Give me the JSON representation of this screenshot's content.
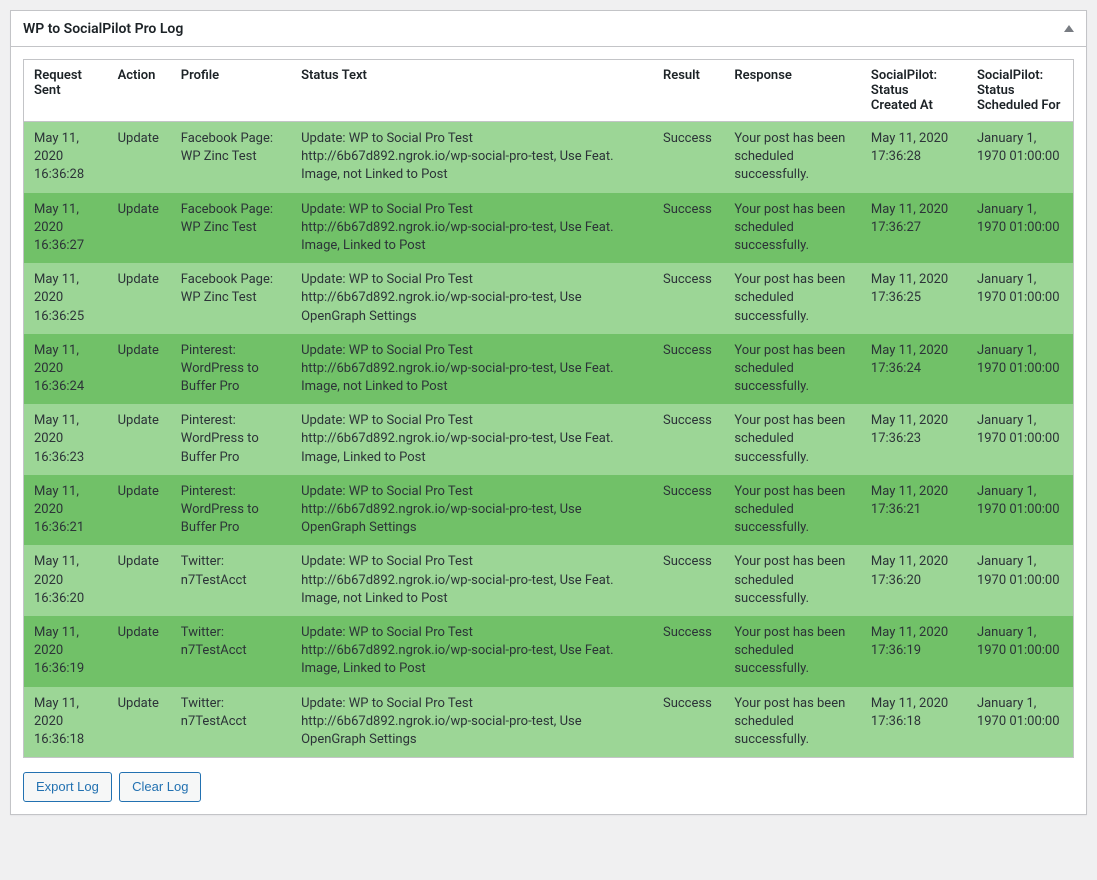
{
  "panel": {
    "title": "WP to SocialPilot Pro Log"
  },
  "table": {
    "headers": {
      "request_sent": "Request Sent",
      "action": "Action",
      "profile": "Profile",
      "status_text": "Status Text",
      "result": "Result",
      "response": "Response",
      "created_at": "SocialPilot: Status Created At",
      "scheduled_for": "SocialPilot: Status Scheduled For"
    },
    "rows": [
      {
        "request_sent": "May 11, 2020 16:36:28",
        "action": "Update",
        "profile": "Facebook Page: WP Zinc Test",
        "status_text": "Update: WP to Social Pro Test http://6b67d892.ngrok.io/wp-social-pro-test, Use Feat. Image, not Linked to Post",
        "result": "Success",
        "response": "Your post has been scheduled successfully.",
        "created_at": "May 11, 2020 17:36:28",
        "scheduled_for": "January 1, 1970 01:00:00"
      },
      {
        "request_sent": "May 11, 2020 16:36:27",
        "action": "Update",
        "profile": "Facebook Page: WP Zinc Test",
        "status_text": "Update: WP to Social Pro Test http://6b67d892.ngrok.io/wp-social-pro-test, Use Feat. Image, Linked to Post",
        "result": "Success",
        "response": "Your post has been scheduled successfully.",
        "created_at": "May 11, 2020 17:36:27",
        "scheduled_for": "January 1, 1970 01:00:00"
      },
      {
        "request_sent": "May 11, 2020 16:36:25",
        "action": "Update",
        "profile": "Facebook Page: WP Zinc Test",
        "status_text": "Update: WP to Social Pro Test http://6b67d892.ngrok.io/wp-social-pro-test, Use OpenGraph Settings",
        "result": "Success",
        "response": "Your post has been scheduled successfully.",
        "created_at": "May 11, 2020 17:36:25",
        "scheduled_for": "January 1, 1970 01:00:00"
      },
      {
        "request_sent": "May 11, 2020 16:36:24",
        "action": "Update",
        "profile": "Pinterest: WordPress to Buffer Pro",
        "status_text": "Update: WP to Social Pro Test http://6b67d892.ngrok.io/wp-social-pro-test, Use Feat. Image, not Linked to Post",
        "result": "Success",
        "response": "Your post has been scheduled successfully.",
        "created_at": "May 11, 2020 17:36:24",
        "scheduled_for": "January 1, 1970 01:00:00"
      },
      {
        "request_sent": "May 11, 2020 16:36:23",
        "action": "Update",
        "profile": "Pinterest: WordPress to Buffer Pro",
        "status_text": "Update: WP to Social Pro Test http://6b67d892.ngrok.io/wp-social-pro-test, Use Feat. Image, Linked to Post",
        "result": "Success",
        "response": "Your post has been scheduled successfully.",
        "created_at": "May 11, 2020 17:36:23",
        "scheduled_for": "January 1, 1970 01:00:00"
      },
      {
        "request_sent": "May 11, 2020 16:36:21",
        "action": "Update",
        "profile": "Pinterest: WordPress to Buffer Pro",
        "status_text": "Update: WP to Social Pro Test http://6b67d892.ngrok.io/wp-social-pro-test, Use OpenGraph Settings",
        "result": "Success",
        "response": "Your post has been scheduled successfully.",
        "created_at": "May 11, 2020 17:36:21",
        "scheduled_for": "January 1, 1970 01:00:00"
      },
      {
        "request_sent": "May 11, 2020 16:36:20",
        "action": "Update",
        "profile": "Twitter: n7TestAcct",
        "status_text": "Update: WP to Social Pro Test http://6b67d892.ngrok.io/wp-social-pro-test, Use Feat. Image, not Linked to Post",
        "result": "Success",
        "response": "Your post has been scheduled successfully.",
        "created_at": "May 11, 2020 17:36:20",
        "scheduled_for": "January 1, 1970 01:00:00"
      },
      {
        "request_sent": "May 11, 2020 16:36:19",
        "action": "Update",
        "profile": "Twitter: n7TestAcct",
        "status_text": "Update: WP to Social Pro Test http://6b67d892.ngrok.io/wp-social-pro-test, Use Feat. Image, Linked to Post",
        "result": "Success",
        "response": "Your post has been scheduled successfully.",
        "created_at": "May 11, 2020 17:36:19",
        "scheduled_for": "January 1, 1970 01:00:00"
      },
      {
        "request_sent": "May 11, 2020 16:36:18",
        "action": "Update",
        "profile": "Twitter: n7TestAcct",
        "status_text": "Update: WP to Social Pro Test http://6b67d892.ngrok.io/wp-social-pro-test, Use OpenGraph Settings",
        "result": "Success",
        "response": "Your post has been scheduled successfully.",
        "created_at": "May 11, 2020 17:36:18",
        "scheduled_for": "January 1, 1970 01:00:00"
      }
    ]
  },
  "buttons": {
    "export": "Export Log",
    "clear": "Clear Log"
  }
}
